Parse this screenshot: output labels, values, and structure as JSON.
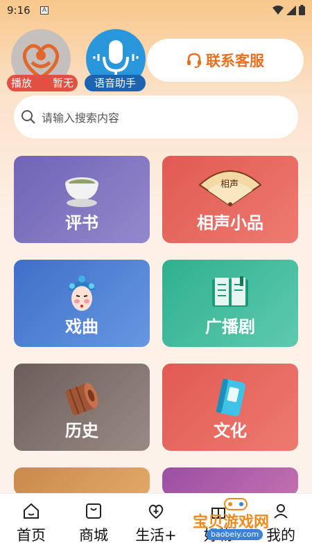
{
  "status": {
    "time": "9:16",
    "notif_letter": "A"
  },
  "header": {
    "play_left": "播放",
    "play_right": "暂无",
    "voice_label": "语音助手",
    "contact_label": "联系客服"
  },
  "search": {
    "placeholder": "请输入搜索内容"
  },
  "tiles": [
    {
      "label": "评书",
      "icon": "tea-bowl-icon"
    },
    {
      "label": "相声小品",
      "icon": "folding-fan-icon",
      "fan_text": "相声"
    },
    {
      "label": "戏曲",
      "icon": "opera-mask-icon"
    },
    {
      "label": "广播剧",
      "icon": "open-book-icon"
    },
    {
      "label": "历史",
      "icon": "scroll-icon"
    },
    {
      "label": "文化",
      "icon": "booklet-icon"
    }
  ],
  "nav": [
    {
      "label": "首页",
      "icon": "home-icon"
    },
    {
      "label": "商城",
      "icon": "bag-icon"
    },
    {
      "label": "生活+",
      "icon": "heart-plus-icon"
    },
    {
      "label": "好物",
      "icon": "gift-icon"
    },
    {
      "label": "我的",
      "icon": "user-icon"
    }
  ],
  "watermark": {
    "text": "宝贝游戏网",
    "url": "baobeiy.com"
  }
}
